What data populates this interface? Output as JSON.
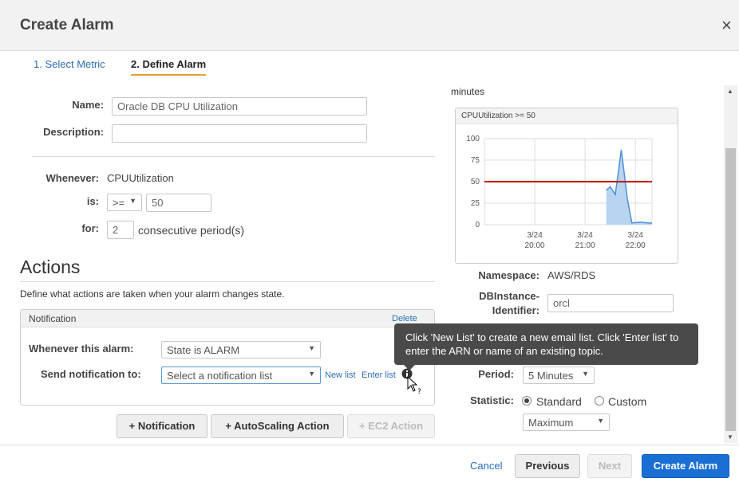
{
  "dialog": {
    "title": "Create Alarm",
    "close": "×"
  },
  "steps": {
    "step1": "1. Select Metric",
    "step2": "2. Define Alarm"
  },
  "form": {
    "name_label": "Name:",
    "name_value": "Oracle DB CPU Utilization",
    "description_label": "Description:",
    "description_value": "",
    "whenever_label": "Whenever:",
    "whenever_value": "CPUUtilization",
    "is_label": "is:",
    "operator": ">=",
    "threshold": "50",
    "for_label": "for:",
    "periods": "2",
    "periods_suffix": "consecutive period(s)"
  },
  "actions": {
    "heading": "Actions",
    "description": "Define what actions are taken when your alarm changes state.",
    "notification": {
      "header": "Notification",
      "delete": "Delete",
      "whenever_label": "Whenever this alarm:",
      "whenever_value": "State is ALARM",
      "send_label": "Send notification to:",
      "send_placeholder": "Select a notification list",
      "new_list": "New list",
      "enter_list": "Enter list"
    },
    "buttons": {
      "notification": "+ Notification",
      "autoscaling": "+ AutoScaling Action",
      "ec2": "+ EC2 Action"
    }
  },
  "tooltip": "Click 'New List' to create a new email list. Click 'Enter list' to enter the ARN or name of an existing topic.",
  "right": {
    "minutes": "minutes",
    "namespace_label": "Namespace:",
    "namespace_value": "AWS/RDS",
    "dbinstance_label_1": "DBInstance-",
    "dbinstance_label_2": "Identifier:",
    "dbinstance_value": "orcl",
    "period_label": "Period:",
    "period_value": "5 Minutes",
    "statistic_label": "Statistic:",
    "standard": "Standard",
    "custom": "Custom",
    "statistic_value": "Maximum"
  },
  "footer": {
    "cancel": "Cancel",
    "previous": "Previous",
    "next": "Next",
    "create": "Create Alarm"
  },
  "chart_data": {
    "type": "line",
    "title": "CPUUtilization >= 50",
    "y_ticks": [
      "100",
      "75",
      "50",
      "25",
      "0"
    ],
    "ylim": [
      0,
      100
    ],
    "x_ticks": [
      {
        "day": "3/24",
        "time": "20:00"
      },
      {
        "day": "3/24",
        "time": "21:00"
      },
      {
        "day": "3/24",
        "time": "22:00"
      }
    ],
    "threshold": 50,
    "series": [
      {
        "values": [
          [
            0.0,
            0
          ],
          [
            2.35,
            0
          ],
          [
            2.42,
            40
          ],
          [
            2.5,
            44
          ],
          [
            2.6,
            35
          ],
          [
            2.72,
            87
          ],
          [
            2.84,
            30
          ],
          [
            2.93,
            2
          ],
          [
            3.1,
            3
          ],
          [
            3.25,
            2
          ],
          [
            3.33,
            2
          ]
        ]
      }
    ],
    "colors": {
      "line": "#4a90d9",
      "fill": "#b8d4f0",
      "threshold": "#cc0000",
      "grid": "#dddddd"
    }
  }
}
